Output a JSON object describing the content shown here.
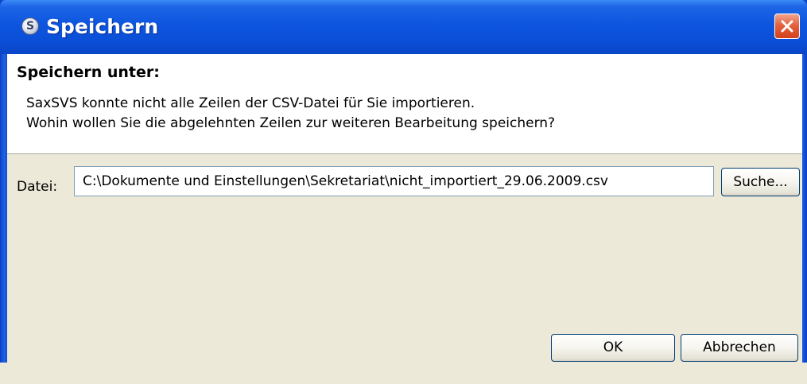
{
  "window": {
    "title": "Speichern",
    "app_icon_glyph": "S"
  },
  "header": {
    "title": "Speichern unter:",
    "message_line1": "SaxSVS konnte nicht alle Zeilen der CSV-Datei für Sie importieren.",
    "message_line2": "Wohin wollen Sie die abgelehnten Zeilen zur weiteren Bearbeitung speichern?"
  },
  "file": {
    "label": "Datei:",
    "value": "C:\\Dokumente und Einstellungen\\Sekretariat\\nicht_importiert_29.06.2009.csv",
    "browse_label": "Suche..."
  },
  "buttons": {
    "ok_label": "OK",
    "cancel_label": "Abbrechen"
  },
  "icons": {
    "app": "app-logo-icon",
    "close": "close-icon"
  },
  "colors": {
    "titlebar": "#0b4fd8",
    "close_button": "#d2411c",
    "dialog_background": "#ece9d8",
    "header_background": "#ffffff"
  }
}
